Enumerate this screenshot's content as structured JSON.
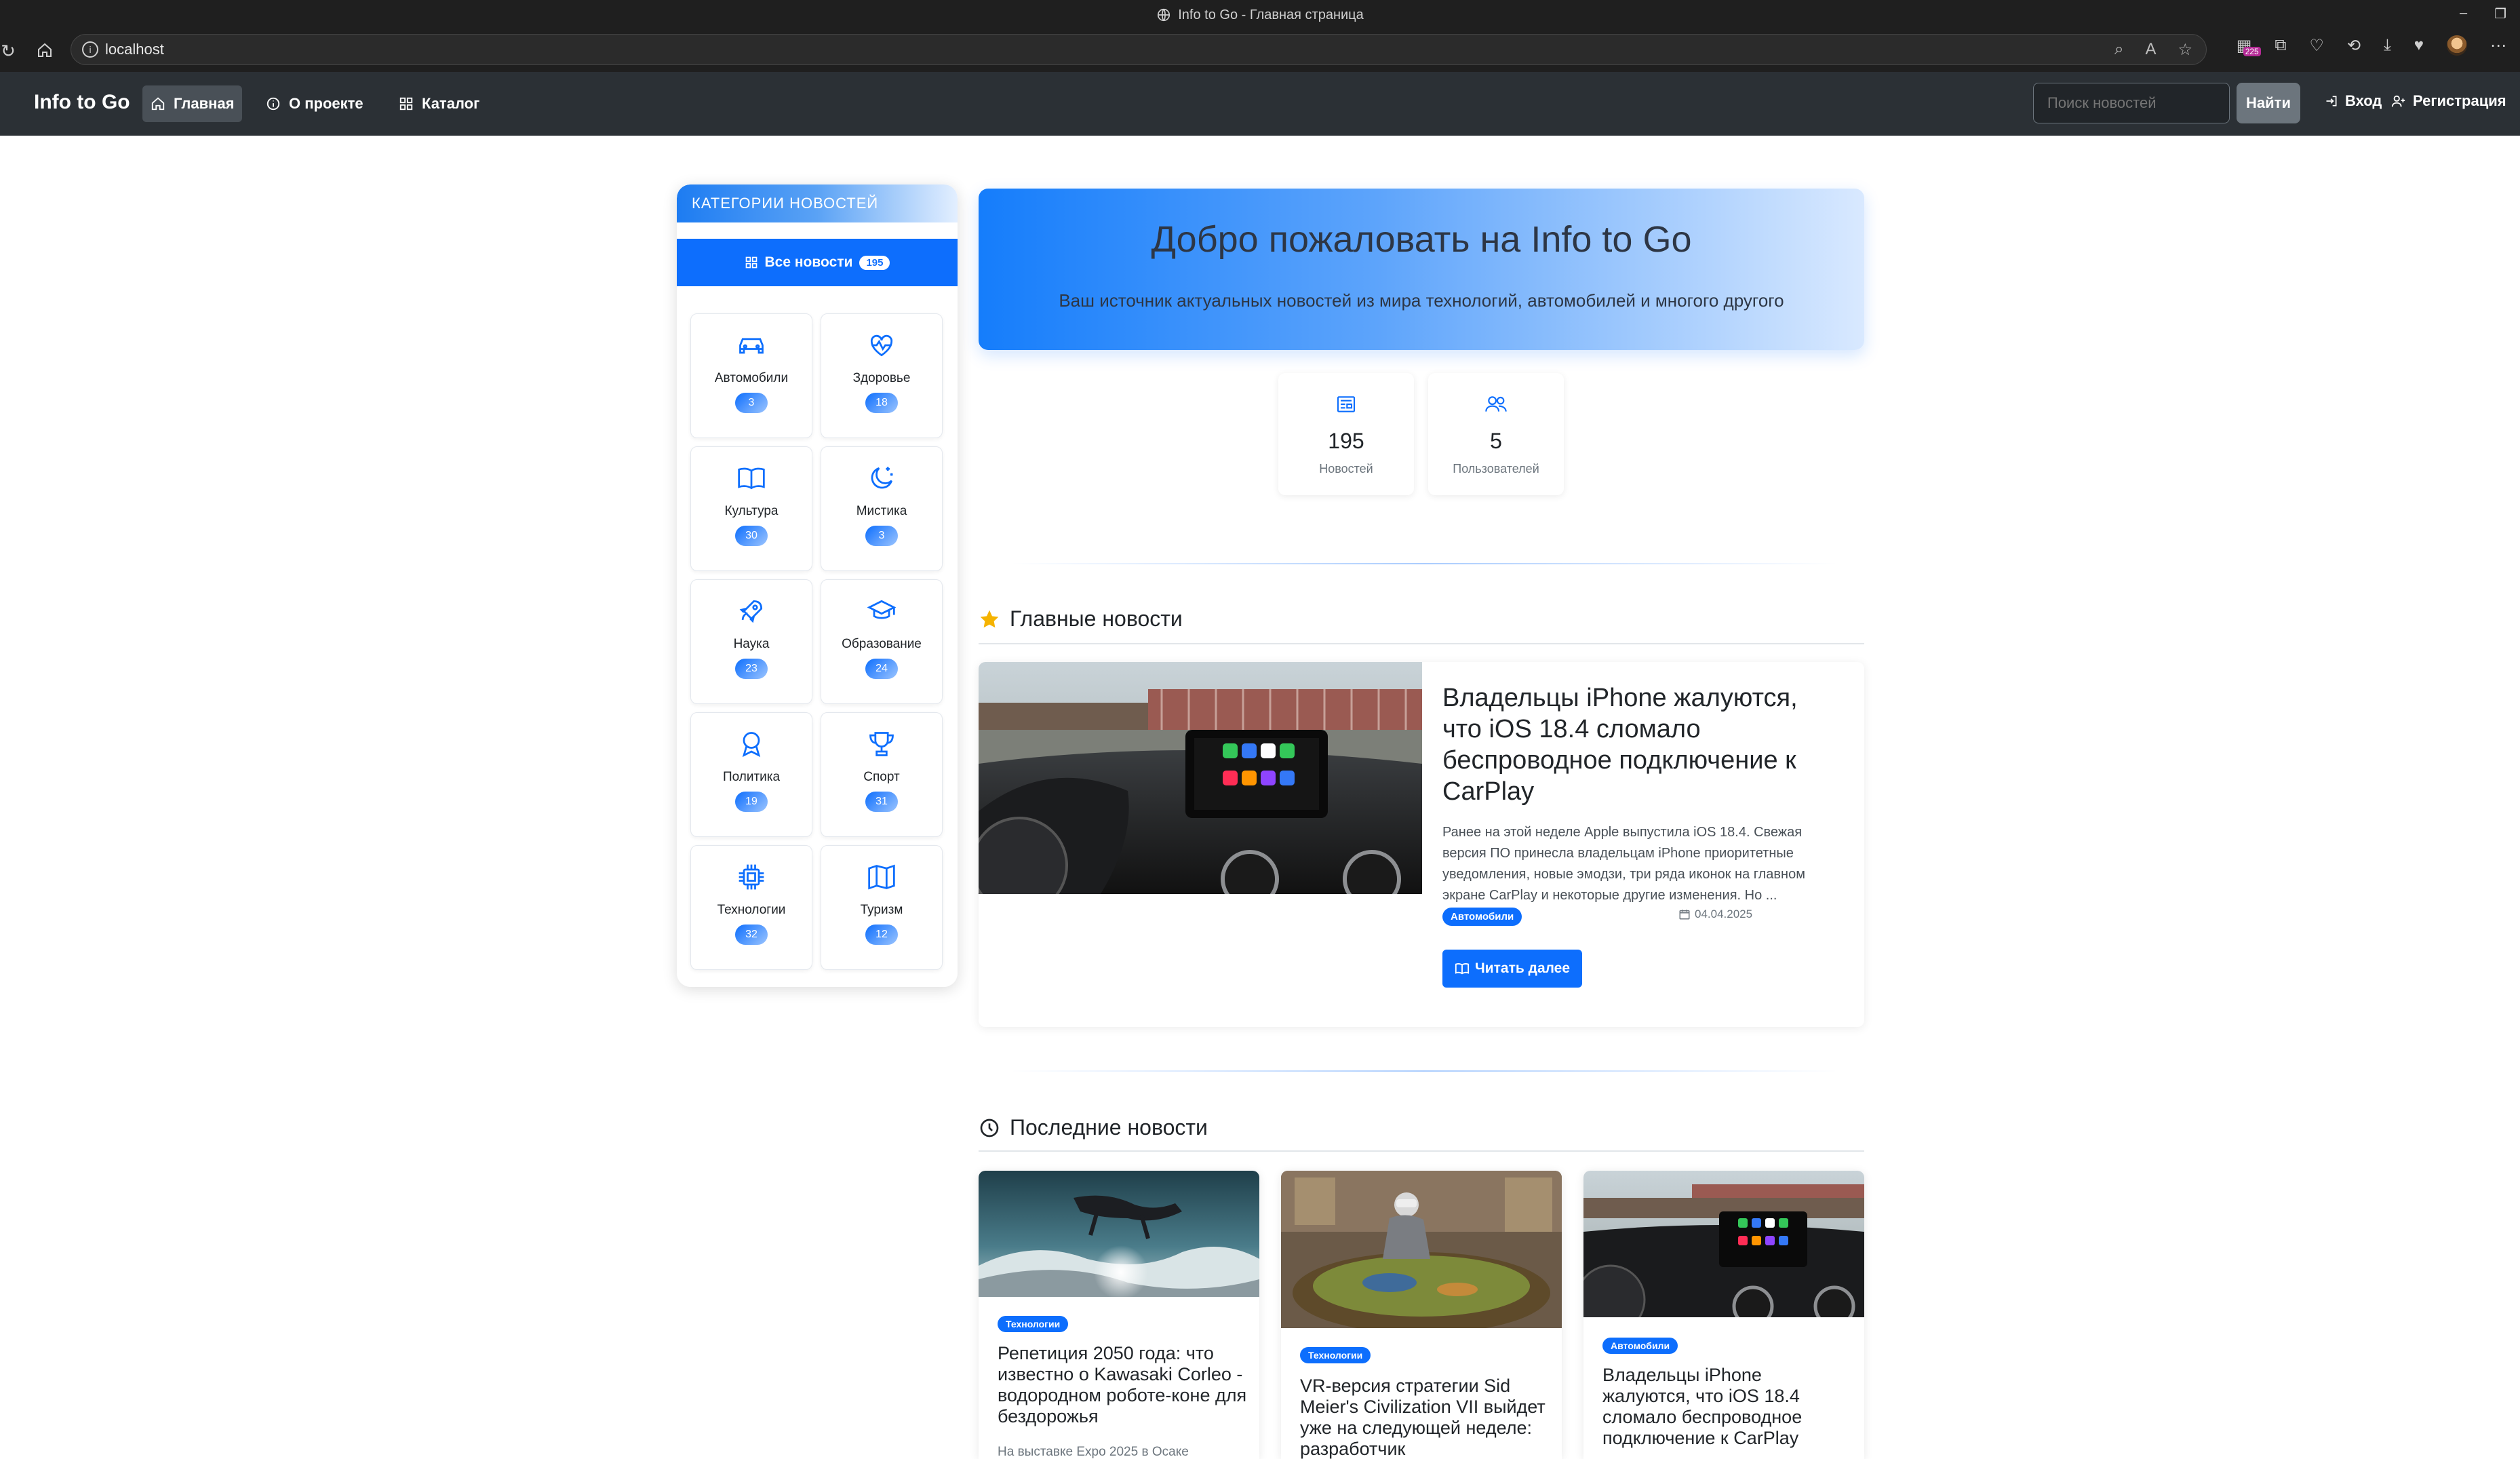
{
  "browser": {
    "tab_title": "Info to Go - Главная страница",
    "url": "localhost",
    "extension_badge": "225"
  },
  "nav": {
    "brand": "Info to Go",
    "links": [
      "Главная",
      "О проекте",
      "Каталог"
    ],
    "search_placeholder": "Поиск новостей",
    "search_button": "Найти",
    "login": "Вход",
    "register": "Регистрация"
  },
  "sidebar": {
    "header": "КАТЕГОРИИ НОВОСТЕЙ",
    "all_label": "Все новости",
    "all_count": "195",
    "categories": [
      {
        "label": "Автомобили",
        "count": "3",
        "icon": "car-icon"
      },
      {
        "label": "Здоровье",
        "count": "18",
        "icon": "heart-pulse-icon"
      },
      {
        "label": "Культура",
        "count": "30",
        "icon": "book-icon"
      },
      {
        "label": "Мистика",
        "count": "3",
        "icon": "moon-stars-icon"
      },
      {
        "label": "Наука",
        "count": "23",
        "icon": "rocket-icon"
      },
      {
        "label": "Образование",
        "count": "24",
        "icon": "mortarboard-icon"
      },
      {
        "label": "Политика",
        "count": "19",
        "icon": "award-icon"
      },
      {
        "label": "Спорт",
        "count": "31",
        "icon": "trophy-icon"
      },
      {
        "label": "Технологии",
        "count": "32",
        "icon": "cpu-icon"
      },
      {
        "label": "Туризм",
        "count": "12",
        "icon": "map-icon"
      }
    ]
  },
  "hero": {
    "title": "Добро пожаловать на Info to Go",
    "subtitle": "Ваш источник актуальных новостей из мира технологий, автомобилей и многого другого"
  },
  "stats": [
    {
      "value": "195",
      "label": "Новостей",
      "icon": "newspaper-icon"
    },
    {
      "value": "5",
      "label": "Пользователей",
      "icon": "people-icon"
    }
  ],
  "main_news": {
    "section_title": "Главные новости",
    "title": "Владельцы iPhone жалуются, что iOS 18.4 сломало беспроводное подключение к CarPlay",
    "excerpt": "Ранее на этой неделе Apple выпустила iOS 18.4. Свежая версия ПО принесла владельцам iPhone приоритетные уведомления, новые эмодзи, три ряда иконок на главном экране CarPlay и некоторые другие изменения. Но ...",
    "category": "Автомобили",
    "date": "04.04.2025",
    "read_more": "Читать далее"
  },
  "latest": {
    "section_title": "Последние новости",
    "cards": [
      {
        "category": "Технологии",
        "title": "Репетиция 2050 года: что известно о Kawasaki Corleo - водородном роботе-коне для бездорожья",
        "excerpt": "На выставке Expo 2025 в Осаке"
      },
      {
        "category": "Технологии",
        "title": "VR-версия стратегии Sid Meier's Civilization VII выйдет уже на следующей неделе: разработчик",
        "excerpt": ""
      },
      {
        "category": "Автомобили",
        "title": "Владельцы iPhone жалуются, что iOS 18.4 сломало беспроводное подключение к CarPlay",
        "excerpt": ""
      }
    ]
  },
  "colors": {
    "primary": "#0d6efd",
    "navbar": "#2b3035",
    "chrome": "#1f1f1f"
  }
}
